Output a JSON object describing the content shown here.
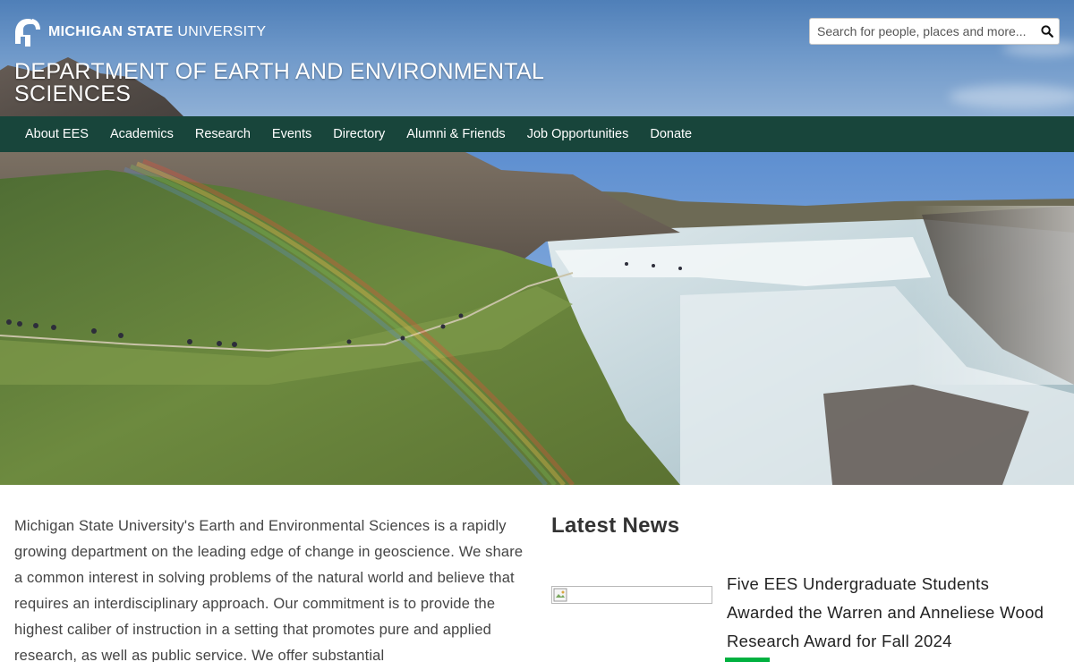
{
  "header": {
    "brand_strong": "MICHIGAN STATE",
    "brand_light": " UNIVERSITY",
    "department_title": "DEPARTMENT OF EARTH AND ENVIRONMENTAL SCIENCES",
    "search": {
      "placeholder": "Search for people, places and more...",
      "icon": "search-icon"
    }
  },
  "nav": {
    "items": [
      {
        "label": "About EES"
      },
      {
        "label": "Academics"
      },
      {
        "label": "Research"
      },
      {
        "label": "Events"
      },
      {
        "label": "Directory"
      },
      {
        "label": "Alumni & Friends"
      },
      {
        "label": "Job Opportunities"
      },
      {
        "label": "Donate"
      }
    ]
  },
  "intro": {
    "text": "Michigan State University's Earth and Environmental Sciences is a rapidly growing department on the leading edge of change in geoscience. We share a common interest in solving problems of the natural world and believe that requires an interdisciplinary approach. Our commitment is to provide the highest caliber of instruction in a setting that promotes pure and applied research, as well as public service. We offer substantial"
  },
  "news": {
    "heading": "Latest News",
    "items": [
      {
        "title": "Five EES Undergraduate Students Awarded the Warren and Anneliese Wood Research Award for Fall 2024"
      }
    ]
  },
  "colors": {
    "nav_bg": "#18453b",
    "accent": "#00b140",
    "text": "#444444"
  }
}
